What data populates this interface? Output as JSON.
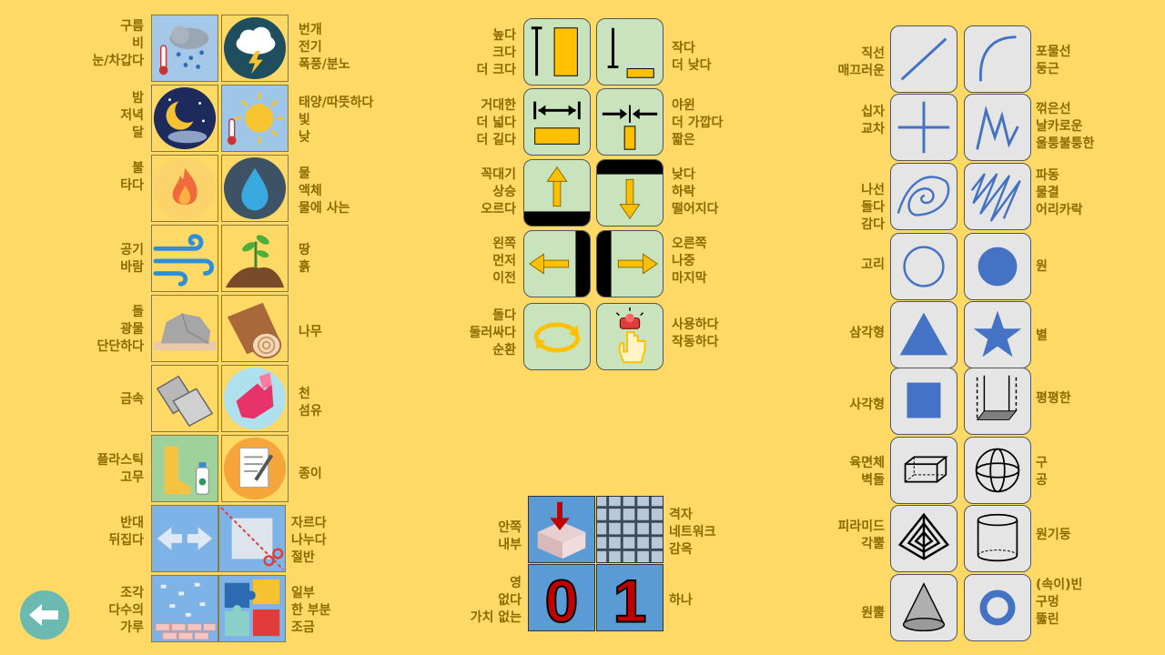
{
  "left_grid": [
    {
      "row": 0,
      "left": [
        "구름",
        "비",
        "눈/차갑다"
      ],
      "right": [
        "번개",
        "전기",
        "폭풍/분노"
      ],
      "tiles": [
        "cloud-rain-snow-icon",
        "cloud-lightning-icon"
      ]
    },
    {
      "row": 1,
      "left": [
        "밤",
        "저녁",
        "달"
      ],
      "right": [
        "태양/따뜻하다",
        "빛",
        "낮"
      ],
      "tiles": [
        "moon-night-icon",
        "sun-icon"
      ]
    },
    {
      "row": 2,
      "left": [
        "불",
        "타다"
      ],
      "right": [
        "물",
        "액체",
        "물에 사는"
      ],
      "tiles": [
        "fire-icon",
        "water-drop-icon"
      ]
    },
    {
      "row": 3,
      "left": [
        "공기",
        "바람"
      ],
      "right": [
        "땅",
        "흙"
      ],
      "tiles": [
        "wind-icon",
        "soil-sprout-icon"
      ]
    },
    {
      "row": 4,
      "left": [
        "돌",
        "광물",
        "단단하다"
      ],
      "right": [
        "나무"
      ],
      "tiles": [
        "rock-icon",
        "log-wood-icon"
      ]
    },
    {
      "row": 5,
      "left": [
        "금속"
      ],
      "right": [
        "천",
        "섬유"
      ],
      "tiles": [
        "metal-sheets-icon",
        "fabric-icon"
      ]
    },
    {
      "row": 6,
      "left": [
        "플라스틱",
        "고무"
      ],
      "right": [
        "종이"
      ],
      "tiles": [
        "boots-bottle-icon",
        "paper-icon"
      ]
    },
    {
      "row": 7,
      "left": [
        "반대",
        "뒤집다"
      ],
      "right": [
        "자르다",
        "나누다",
        "절반"
      ],
      "tiles": [
        "opposite-arrows-icon",
        "scissors-cut-icon"
      ]
    },
    {
      "row": 8,
      "left": [
        "조각",
        "다수의",
        "가루"
      ],
      "right": [
        "일부",
        "한 부분",
        "조금"
      ],
      "tiles": [
        "pieces-bricks-icon",
        "puzzle-icon"
      ]
    }
  ],
  "middle_grid": [
    {
      "left": [
        "높다",
        "크다",
        "더 크다"
      ],
      "right": [
        "작다",
        "더 낮다"
      ],
      "tiles": [
        "tall-bar-icon",
        "short-bar-icon"
      ]
    },
    {
      "left": [
        "거대한",
        "더 넓다",
        "더 길다"
      ],
      "right": [
        "야윈",
        "더 가깝다",
        "짧은"
      ],
      "tiles": [
        "wide-arrows-icon",
        "narrow-arrows-icon"
      ]
    },
    {
      "left": [
        "꼭대기",
        "상승",
        "오르다"
      ],
      "right": [
        "낮다",
        "하락",
        "떨어지다"
      ],
      "tiles": [
        "up-arrow-icon",
        "down-arrow-icon"
      ]
    },
    {
      "left": [
        "왼쪽",
        "먼저",
        "이전"
      ],
      "right": [
        "오른쪽",
        "나중",
        "마지막"
      ],
      "tiles": [
        "left-arrow-icon",
        "right-arrow-icon"
      ]
    },
    {
      "left": [
        "돌다",
        "둘러싸다",
        "순환"
      ],
      "right": [
        "사용하다",
        "작동하다"
      ],
      "tiles": [
        "cycle-arrows-icon",
        "press-button-icon"
      ]
    }
  ],
  "bottom_grid": [
    {
      "left": [
        "안쪽",
        "내부"
      ],
      "right": [
        "격자",
        "네트워크",
        "감옥"
      ],
      "tiles": [
        "inside-box-icon",
        "grid-icon"
      ]
    },
    {
      "left": [
        "영",
        "없다",
        "가치 없는"
      ],
      "right": [
        "하나"
      ],
      "tiles": [
        "zero-icon",
        "one-icon"
      ]
    }
  ],
  "digits": {
    "zero": "0",
    "one": "1"
  },
  "right_grid": [
    {
      "left": [
        "직선",
        "매끄러운"
      ],
      "right": [
        "포물선",
        "둥근"
      ],
      "tiles": [
        "straight-line-icon",
        "curve-icon"
      ]
    },
    {
      "left": [
        "십자",
        "교차"
      ],
      "right": [
        "꺾은선",
        "날카로운",
        "울퉁불퉁한"
      ],
      "tiles": [
        "cross-icon",
        "zigzag-icon"
      ]
    },
    {
      "left": [
        "나선",
        "돌다",
        "감다"
      ],
      "right": [
        "파동",
        "물결",
        "어리카락"
      ],
      "tiles": [
        "spiral-icon",
        "wave-icon"
      ]
    },
    {
      "left": [
        "고리"
      ],
      "right": [
        "원"
      ],
      "tiles": [
        "ring-icon",
        "circle-icon"
      ]
    },
    {
      "left": [
        "삼각형"
      ],
      "right": [
        "별"
      ],
      "tiles": [
        "triangle-icon",
        "star-icon"
      ]
    },
    {
      "left": [
        "사각형"
      ],
      "right": [
        "평평한"
      ],
      "tiles": [
        "square-icon",
        "flat-icon"
      ]
    },
    {
      "left": [
        "육면체",
        "벽돌"
      ],
      "right": [
        "구",
        "공"
      ],
      "tiles": [
        "cube-icon",
        "sphere-icon"
      ]
    },
    {
      "left": [
        "피라미드",
        "각뿔"
      ],
      "right": [
        "원기둥"
      ],
      "tiles": [
        "pyramid-icon",
        "cylinder-icon"
      ]
    },
    {
      "left": [
        "원뿔"
      ],
      "right": [
        "(속이)빈",
        "구멍",
        "뚫린"
      ],
      "tiles": [
        "cone-icon",
        "hole-ring-icon"
      ]
    }
  ],
  "colors": {
    "background": "#FFD966",
    "label": "#8B6A00",
    "accent_blue": "#4472C4",
    "tile_green": "#C9E3BC",
    "tile_gray": "#E5E5E5",
    "back_button": "#6CB9B1"
  },
  "back_button_icon": "back-arrow-icon"
}
